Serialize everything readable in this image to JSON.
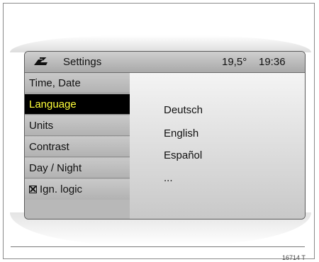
{
  "header": {
    "title": "Settings",
    "temperature": "19,5°",
    "time": "19:36",
    "icon": "car-settings-icon"
  },
  "menu": {
    "items": [
      {
        "label": "Time, Date"
      },
      {
        "label": "Language",
        "selected": true
      },
      {
        "label": "Units"
      },
      {
        "label": "Contrast"
      },
      {
        "label": "Day / Night"
      },
      {
        "label": "Ign. logic",
        "checkbox": "checked"
      }
    ]
  },
  "options": [
    "Deutsch",
    "English",
    "Español",
    "..."
  ],
  "caption": "16714 T",
  "colors": {
    "selected_text": "#ffff3a",
    "selected_background": "#000000"
  }
}
